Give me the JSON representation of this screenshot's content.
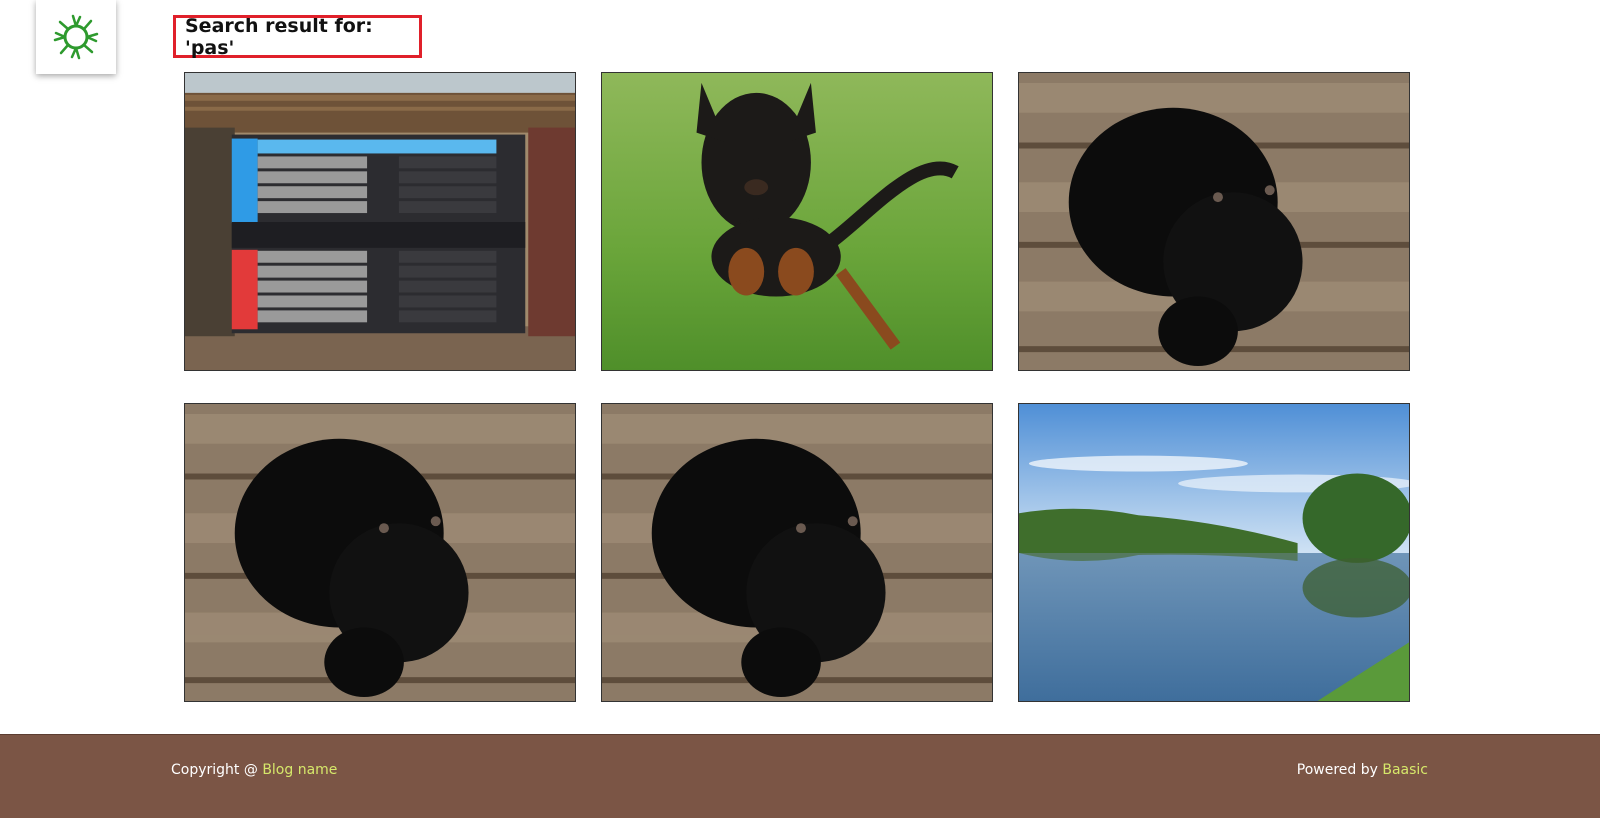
{
  "header": {
    "logo_icon": "green-sun-logo-icon",
    "search_heading": "Search result for: 'pas'"
  },
  "results": [
    {
      "icon": "game-scoreboard-photo"
    },
    {
      "icon": "running-dog-photo"
    },
    {
      "icon": "black-puppy-photo"
    },
    {
      "icon": "black-puppy-photo"
    },
    {
      "icon": "black-puppy-photo"
    },
    {
      "icon": "river-landscape-photo"
    }
  ],
  "footer": {
    "copyright_prefix": "Copyright @ ",
    "blog_link": "Blog name",
    "powered_prefix": "Powered by ",
    "powered_link": "Baasic"
  },
  "colors": {
    "accent_red": "#e0202a",
    "footer_bg": "#7b5545",
    "footer_link": "#d6e86a",
    "logo_green": "#2e9a2e"
  }
}
